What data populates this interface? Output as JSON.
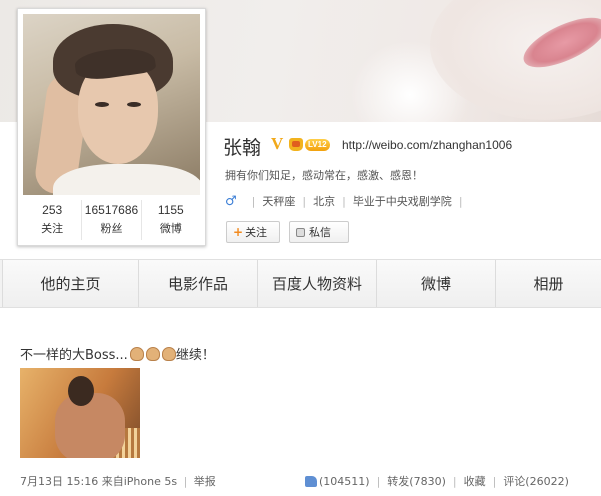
{
  "profile": {
    "name": "张翰",
    "verified_mark": "V",
    "level_badge": "LV12",
    "url": "http://weibo.com/zhanghan1006",
    "bio": "拥有你们知足，感动常在，感激、感恩！",
    "gender_icon": "male-icon",
    "zodiac": "天秤座",
    "city": "北京",
    "school": "毕业于中央戏剧学院"
  },
  "stats": [
    {
      "value": "253",
      "label": "关注"
    },
    {
      "value": "16517686",
      "label": "粉丝"
    },
    {
      "value": "1155",
      "label": "微博"
    }
  ],
  "buttons": {
    "follow": "关注",
    "follow_icon": "+",
    "message": "私信"
  },
  "tabs": [
    "他的主页",
    "电影作品",
    "百度人物资料",
    "微博",
    "相册"
  ],
  "post": {
    "text": "不一样的大Boss...",
    "text_after": "继续！",
    "emoji_icon": "muscle-emoji-icon",
    "time": "7月13日 15:16",
    "source": "来自iPhone 5s",
    "report": "举报",
    "likes": "(104511)",
    "repost": "转发(7830)",
    "favorite": "收藏",
    "comments": "评论(26022)"
  },
  "colors": {
    "level_badge": "#f2a10e",
    "verified": "#f1a91a",
    "follow_plus": "#f28a1e",
    "male": "#3b7ed6"
  }
}
